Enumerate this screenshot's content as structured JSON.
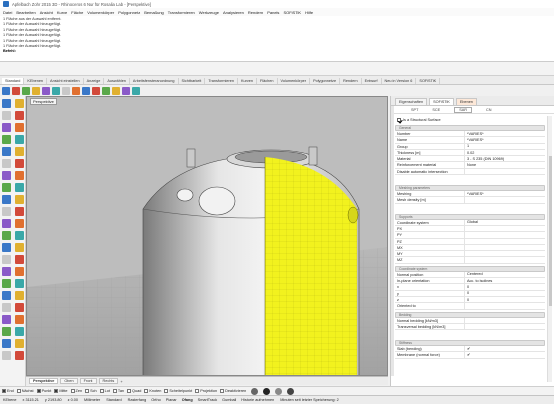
{
  "window": {
    "title": "Apfelbach Zohr 2015 3D - Rhinoceros 6 Nur für Rosalia Lab - [Perspektive]"
  },
  "menu": [
    "Datei",
    "Bearbeiten",
    "Ansicht",
    "Kurve",
    "Fläche",
    "Volumenkörper",
    "Polygonnetz",
    "Bemaßung",
    "Transformieren",
    "Werkzeuge",
    "Analysieren",
    "Rendern",
    "Panels",
    "SOFiSTiK",
    "Hilfe"
  ],
  "command_history": {
    "lines": [
      "1 Fläche aus der Auswahl entfernt.",
      "1 Fläche der Auswahl hinzugefügt.",
      "1 Fläche der Auswahl hinzugefügt.",
      "1 Fläche der Auswahl hinzugefügt.",
      "1 Fläche der Auswahl hinzugefügt.",
      "1 Fläche der Auswahl hinzugefügt."
    ],
    "prompt": "Befehl:"
  },
  "ribbon_tabs": [
    "Standard",
    "KEbenen",
    "Ansicht einstellen",
    "Anzeige",
    "Auswählen",
    "Arbeitsfensteranordnung",
    "Sichtbarkeit",
    "Transformieren",
    "Kurven",
    "Flächen",
    "Volumenkörper",
    "Polygonnetze",
    "Rendern",
    "Entwurf",
    "Neu in Version 6",
    "SOFiSTiK"
  ],
  "viewport": {
    "label": "Perspektive",
    "surface_color": "#f2f21e",
    "bg_color": "#bdbdbd"
  },
  "view_tabs": {
    "items": [
      "Perspektive",
      "Oben",
      "Front",
      "Rechts"
    ],
    "add": "+"
  },
  "osnap": {
    "items": [
      {
        "label": "End",
        "on": true
      },
      {
        "label": "Nächst",
        "on": false
      },
      {
        "label": "Punkt",
        "on": true
      },
      {
        "label": "Mitte",
        "on": true
      },
      {
        "label": "Zen",
        "on": false
      },
      {
        "label": "Sch",
        "on": false
      },
      {
        "label": "Lot",
        "on": false
      },
      {
        "label": "Tan",
        "on": false
      },
      {
        "label": "Quad",
        "on": false
      },
      {
        "label": "Knoten",
        "on": false
      },
      {
        "label": "Scheitelpunkt",
        "on": false
      },
      {
        "label": "Projektion",
        "on": false
      },
      {
        "label": "Deaktivieren",
        "on": false
      }
    ]
  },
  "status": {
    "plane": "KEbene",
    "x": "x 3115.21",
    "y": "y 2193.80",
    "z": "z 0.00",
    "unit": "Millimeter",
    "layer": "Standard",
    "toggles": [
      "Rasterfang",
      "Ortho",
      "Planar",
      "Ofang",
      "SmartTrack",
      "Gumball",
      "Historie aufnehmen"
    ],
    "autosave": "Minuten seit letzter Speicherung: 2"
  },
  "panel": {
    "tabs": [
      "Eigenschaften",
      "SOFiSTiK",
      "Ebenen"
    ],
    "subtabs": [
      "SPT",
      "SCE",
      "SAR",
      "CN"
    ],
    "is_structural": {
      "label": "Is a Structural Surface",
      "checked": true
    },
    "sections": {
      "general": "General",
      "meshing": "Meshing parameters",
      "supports": "Supports",
      "coordinate": "Coordinate system",
      "bedding": "Bedding",
      "stiffness": "Stiffness"
    },
    "general_rows": [
      {
        "k": "Number",
        "v": "*VARIES*"
      },
      {
        "k": "Name",
        "v": "*VARIES*"
      },
      {
        "k": "Group",
        "v": "1"
      },
      {
        "k": "Thickness [m]",
        "v": "0.02"
      },
      {
        "k": "Material",
        "v": "3 - S 235 (DIN 10969)"
      },
      {
        "k": "Reinforcement material",
        "v": "None"
      },
      {
        "k": "Disable automatic intersection",
        "v": ""
      }
    ],
    "meshing_rows": [
      {
        "k": "Meshing",
        "v": "*VARIES*"
      },
      {
        "k": "Mesh density [m]",
        "v": ""
      }
    ],
    "supports_rows": [
      {
        "k": "Coordinate system",
        "v": "Global"
      },
      {
        "k": "PX",
        "v": ""
      },
      {
        "k": "PY",
        "v": ""
      },
      {
        "k": "PZ",
        "v": ""
      },
      {
        "k": "MX",
        "v": ""
      },
      {
        "k": "MY",
        "v": ""
      },
      {
        "k": "MZ",
        "v": ""
      }
    ],
    "coordinate_rows": [
      {
        "k": "Normal position",
        "v": "Centered"
      },
      {
        "k": "In-plane orientation",
        "v": "Acc. to isolines"
      },
      {
        "k": "x",
        "v": "0"
      },
      {
        "k": "y",
        "v": "0"
      },
      {
        "k": "z",
        "v": "0"
      },
      {
        "k": "Oriented to",
        "v": ""
      }
    ],
    "bedding_rows": [
      {
        "k": "Normal bedding [kN/m3]",
        "v": ""
      },
      {
        "k": "Transversal bedding [kN/m3]",
        "v": ""
      }
    ],
    "stiffness_rows": [
      {
        "k": "Slab (bending)",
        "v": "✔"
      },
      {
        "k": "Membrane (normal force)",
        "v": "✔"
      }
    ]
  },
  "colors": {
    "tool_palette": [
      "#3a78c8",
      "#d24a3a",
      "#5aa84a",
      "#e0b030",
      "#8a5ac8",
      "#3aa8a8",
      "#c8c8c8",
      "#e07030"
    ],
    "status_dots": [
      "#666666",
      "#222222",
      "#888888",
      "#444444"
    ]
  }
}
